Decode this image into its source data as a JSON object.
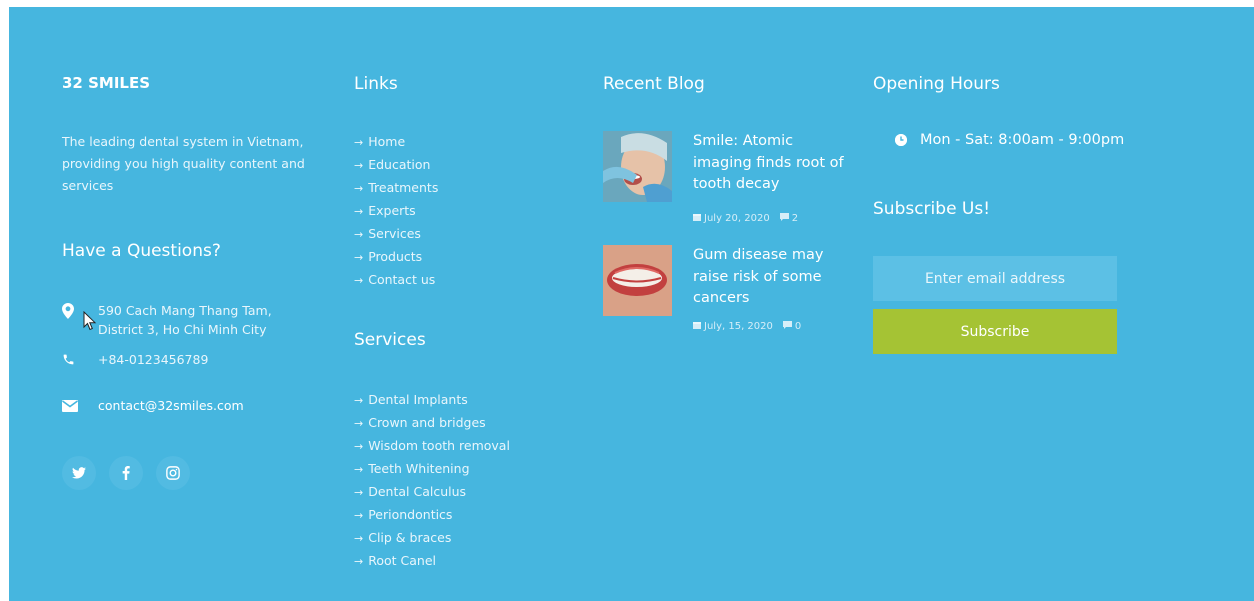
{
  "brand": {
    "title": "32 SMILES",
    "description": "The leading dental system in Vietnam, providing you high quality content and services"
  },
  "contact": {
    "heading": "Have a Questions?",
    "address": "590 Cach Mang Thang Tam, District 3, Ho Chi Minh City",
    "phone": "+84-0123456789",
    "email": "contact@32smiles.com"
  },
  "social": [
    "twitter-icon",
    "facebook-icon",
    "instagram-icon"
  ],
  "links": {
    "heading": "Links",
    "items": [
      "Home",
      "Education",
      "Treatments",
      "Experts",
      "Services",
      "Products",
      "Contact us"
    ]
  },
  "services": {
    "heading": "Services",
    "items": [
      "Dental Implants",
      "Crown and bridges",
      "Wisdom tooth removal",
      "Teeth Whitening",
      "Dental Calculus",
      "Periondontics",
      "Clip & braces",
      "Root Canel"
    ]
  },
  "blog": {
    "heading": "Recent Blog",
    "posts": [
      {
        "title": "Smile: Atomic imaging finds root of tooth decay",
        "date": "July 20, 2020",
        "comments": "2"
      },
      {
        "title": "Gum disease may raise risk of some cancers",
        "date": "July, 15, 2020",
        "comments": "0"
      }
    ]
  },
  "hours": {
    "heading": "Opening Hours",
    "text": "Mon - Sat: 8:00am - 9:00pm"
  },
  "subscribe": {
    "heading": "Subscribe Us!",
    "placeholder": "Enter email address",
    "button": "Subscribe"
  },
  "colors": {
    "background": "#46b6df",
    "button": "#a5c334",
    "input": "#5cc0e5"
  }
}
